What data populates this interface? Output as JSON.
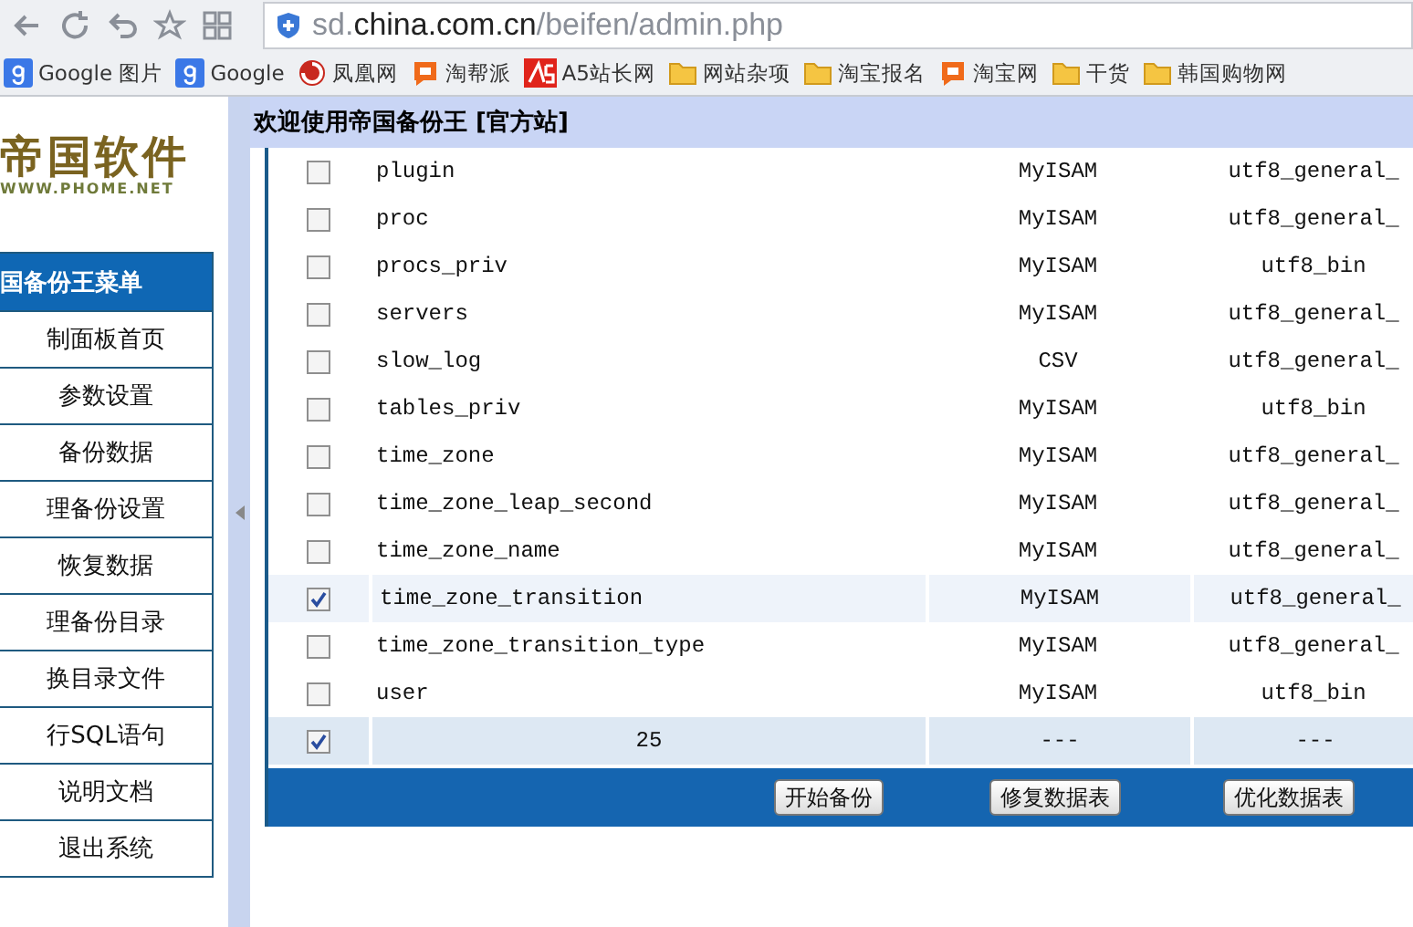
{
  "browser": {
    "url": {
      "prefix": "sd.",
      "domain": "china.com.cn",
      "path": "/beifen/admin.php"
    },
    "bookmarks": [
      {
        "label": "Google 图片",
        "kind": "google"
      },
      {
        "label": "Google",
        "kind": "google"
      },
      {
        "label": "凤凰网",
        "kind": "swirl"
      },
      {
        "label": "淘帮派",
        "kind": "tao"
      },
      {
        "label": "A5站长网",
        "kind": "a5"
      },
      {
        "label": "网站杂项",
        "kind": "folder"
      },
      {
        "label": "淘宝报名",
        "kind": "folder"
      },
      {
        "label": "淘宝网",
        "kind": "tao"
      },
      {
        "label": "干货",
        "kind": "folder"
      },
      {
        "label": "韩国购物网",
        "kind": "folder"
      }
    ]
  },
  "sidebar": {
    "logo": {
      "title": "帝国软件",
      "subtitle": "WWW.PHOME.NET"
    },
    "menu_title": "国备份王菜单",
    "items": [
      "制面板首页",
      "参数设置",
      "备份数据",
      "理备份设置",
      "恢复数据",
      "理备份目录",
      "换目录文件",
      "行SQL语句",
      "说明文档",
      "退出系统"
    ]
  },
  "header": {
    "title": "欢迎使用帝国备份王 [官方站]"
  },
  "table": {
    "rows": [
      {
        "kind": "table",
        "checked": false,
        "name": "plugin",
        "engine": "MyISAM",
        "collation": "utf8_general_"
      },
      {
        "kind": "table",
        "checked": false,
        "name": "proc",
        "engine": "MyISAM",
        "collation": "utf8_general_"
      },
      {
        "kind": "table",
        "checked": false,
        "name": "procs_priv",
        "engine": "MyISAM",
        "collation": "utf8_bin"
      },
      {
        "kind": "table",
        "checked": false,
        "name": "servers",
        "engine": "MyISAM",
        "collation": "utf8_general_"
      },
      {
        "kind": "table",
        "checked": false,
        "name": "slow_log",
        "engine": "CSV",
        "collation": "utf8_general_"
      },
      {
        "kind": "table",
        "checked": false,
        "name": "tables_priv",
        "engine": "MyISAM",
        "collation": "utf8_bin"
      },
      {
        "kind": "table",
        "checked": false,
        "name": "time_zone",
        "engine": "MyISAM",
        "collation": "utf8_general_"
      },
      {
        "kind": "table",
        "checked": false,
        "name": "time_zone_leap_second",
        "engine": "MyISAM",
        "collation": "utf8_general_"
      },
      {
        "kind": "table",
        "checked": false,
        "name": "time_zone_name",
        "engine": "MyISAM",
        "collation": "utf8_general_"
      },
      {
        "kind": "table",
        "checked": true,
        "name": "time_zone_transition",
        "engine": "MyISAM",
        "collation": "utf8_general_"
      },
      {
        "kind": "table",
        "checked": false,
        "name": "time_zone_transition_type",
        "engine": "MyISAM",
        "collation": "utf8_general_"
      },
      {
        "kind": "table",
        "checked": false,
        "name": "user",
        "engine": "MyISAM",
        "collation": "utf8_bin"
      },
      {
        "kind": "total",
        "checked": true,
        "name": "25",
        "engine": "---",
        "collation": "---"
      }
    ],
    "buttons": [
      "开始备份",
      "修复数据表",
      "优化数据表"
    ]
  }
}
